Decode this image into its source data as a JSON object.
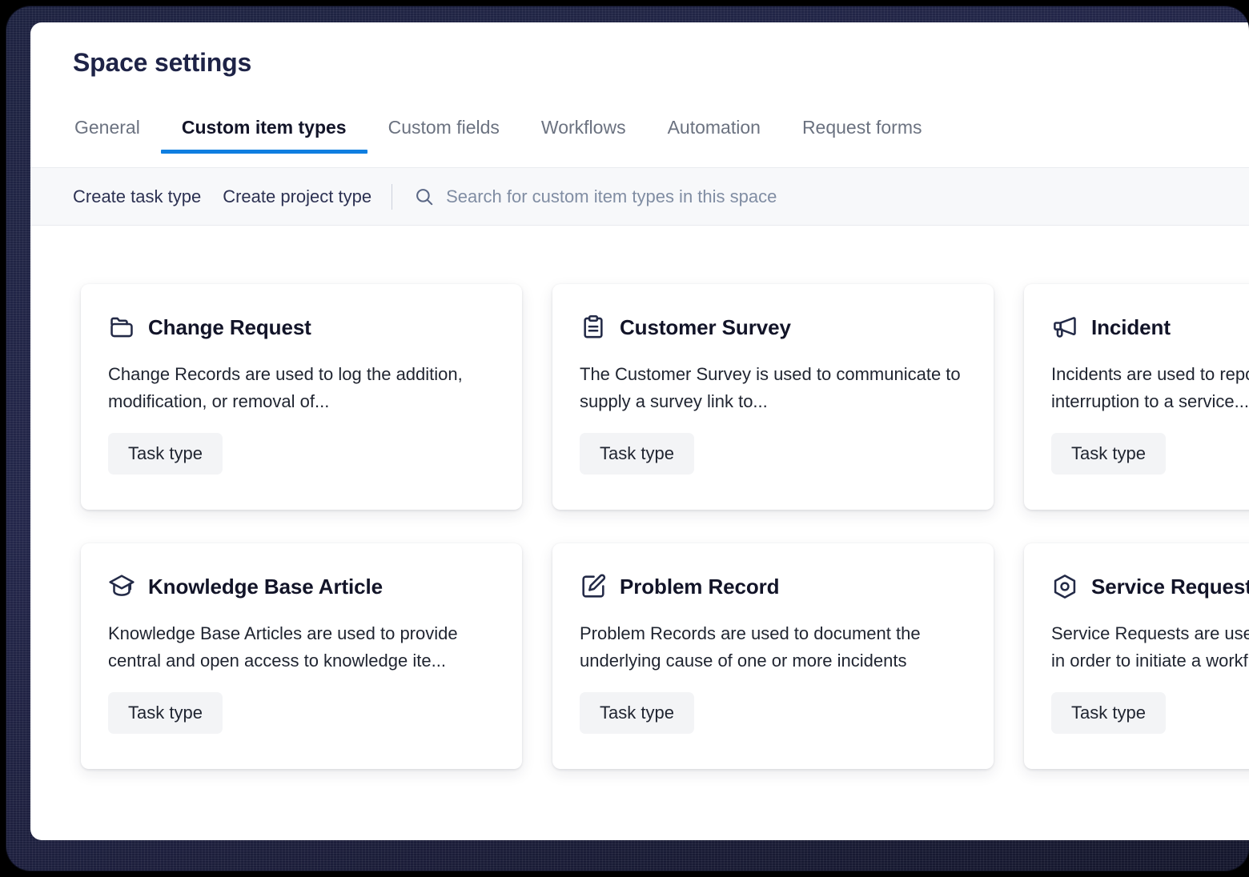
{
  "window": {
    "title": "Space settings"
  },
  "tabs": [
    {
      "label": "General",
      "active": false
    },
    {
      "label": "Custom item types",
      "active": true
    },
    {
      "label": "Custom fields",
      "active": false
    },
    {
      "label": "Workflows",
      "active": false
    },
    {
      "label": "Automation",
      "active": false
    },
    {
      "label": "Request forms",
      "active": false
    }
  ],
  "toolbar": {
    "create_task_type": "Create task type",
    "create_project_type": "Create project type",
    "search_icon": "search-icon",
    "search_placeholder": "Search for custom item types in this space"
  },
  "cards": [
    {
      "icon": "folder-icon",
      "title": "Change Request",
      "description": "Change Records are used to log the addition, modification, or removal of...",
      "badge": "Task type"
    },
    {
      "icon": "clipboard-icon",
      "title": "Customer Survey",
      "description": "The Customer Survey is used to communicate to supply a survey link to...",
      "badge": "Task type"
    },
    {
      "icon": "megaphone-icon",
      "title": "Incident",
      "description": "Incidents are used to report an unplanned interruption to a service...",
      "badge": "Task type"
    },
    {
      "icon": "graduation-cap-icon",
      "title": "Knowledge Base Article",
      "description": "Knowledge Base Articles are used to provide central and open access to knowledge ite...",
      "badge": "Task type"
    },
    {
      "icon": "edit-square-icon",
      "title": "Problem Record",
      "description": "Problem Records are used to document the underlying cause of one or more incidents",
      "badge": "Task type"
    },
    {
      "icon": "hexagon-target-icon",
      "title": "Service Request",
      "description": "Service Requests are used to request a service in order to initiate a workflow...",
      "badge": "Task type"
    }
  ],
  "colors": {
    "accent": "#0f7ee0",
    "icon": "#232a47",
    "title": "#1e2347",
    "toolbar_bg": "#f7f8fa",
    "chip_bg": "#f3f4f6"
  }
}
